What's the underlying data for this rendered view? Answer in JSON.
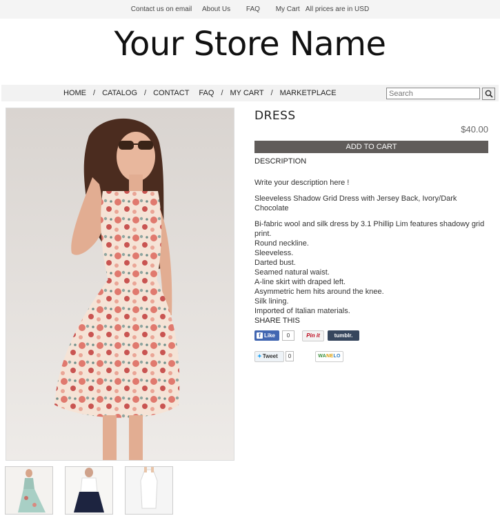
{
  "topbar": {
    "links": [
      "Contact us on email",
      "About Us",
      "FAQ",
      "My Cart"
    ],
    "currency_note": "All prices are in USD"
  },
  "store": {
    "name": "Your Store Name"
  },
  "nav": {
    "items": [
      "HOME",
      "CATALOG",
      "CONTACT",
      "FAQ",
      "MY CART",
      "MARKETPLACE"
    ],
    "separator": "/"
  },
  "search": {
    "placeholder": "Search",
    "icon": "search-icon"
  },
  "product": {
    "title": "DRESS",
    "price": "$40.00",
    "add_to_cart": "ADD TO CART",
    "description_heading": "DESCRIPTION",
    "description_intro": "Write your description here !",
    "description_subtitle": "Sleeveless Shadow Grid Dress with Jersey Back, Ivory/Dark Chocolate",
    "description_lines": [
      "Bi-fabric wool and silk dress by 3.1 Phillip Lim features shadowy grid print.",
      "Round neckline.",
      "Sleeveless.",
      "Darted bust.",
      "Seamed natural waist.",
      "A-line skirt with draped left.",
      "Asymmetric hem hits around the knee.",
      "Silk lining.",
      "Imported of Italian materials."
    ]
  },
  "share": {
    "heading": "SHARE THIS",
    "facebook_label": "Like",
    "facebook_count": "0",
    "pinterest_label": "Pin it",
    "tumblr_label": "tumblr.",
    "tweet_label": "Tweet",
    "tweet_count": "0",
    "wanelo_a": "WA",
    "wanelo_b": "NE",
    "wanelo_c": "LO"
  },
  "colors": {
    "button_bg": "#605c5a",
    "facebook": "#4267b2",
    "tumblr": "#36465d",
    "pinterest": "#bd081c"
  }
}
